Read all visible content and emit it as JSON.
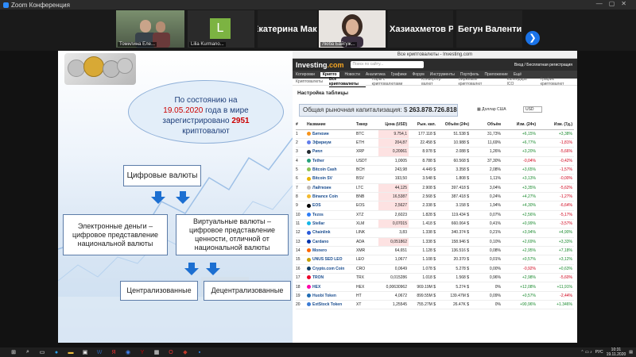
{
  "window": {
    "title": "Zoom Конференция"
  },
  "participants": [
    {
      "name": "Томилина Еле...",
      "kind": "video"
    },
    {
      "name": "Lilia Kurmano...",
      "kind": "avatar",
      "initial": "L"
    },
    {
      "name": "Екатерина Мак...",
      "kind": "name"
    },
    {
      "name": "Люба Байгуж...",
      "kind": "video"
    },
    {
      "name": "Хазиахметов Р...",
      "kind": "name"
    },
    {
      "name": "Бегун Валенти...",
      "kind": "name"
    }
  ],
  "gallery": {
    "next_label": "❯"
  },
  "slide": {
    "bubble_line1": "По состоянию на",
    "bubble_date": "19.05.2020",
    "bubble_line2": " года в мире",
    "bubble_line3": "зарегистрировано ",
    "bubble_count": "2951",
    "bubble_line4": "криптовалют",
    "digital": "Цифровые валюты",
    "electronic": "Электронные деньги – цифровое представление национальной валюты",
    "virtual": "Виртуальные валюты – цифровое представление ценности, отличной от национальной валюты",
    "centralized": "Централизованные",
    "decentralized": "Децентрализованные"
  },
  "browser": {
    "tab_title": "Все криптовалюты - Investing.com",
    "logo_main": "Investing",
    "logo_dot": ".com",
    "search_placeholder": "Поиск по сайту...",
    "header_right": "Вход / Бесплатная регистрация",
    "nav": [
      "Котировки",
      "Крипто",
      "Новости",
      "Аналитика",
      "Графики",
      "Форум",
      "Инструменты",
      "Портфель",
      "Приложение",
      "Ещё"
    ],
    "subnav": [
      "Криптовалюты",
      "Все криптовалюты",
      "Пары с криптовалютами",
      "Конвертер валют",
      "Биржевые криптовалют",
      "Календарь ICO",
      "График криптовалют"
    ],
    "section_title": "Настройка таблицы",
    "market_cap_label": "Общая рыночная капитализация: $ ",
    "market_cap_value": "263.878.726.818",
    "currency_label": "Доллар США",
    "currency_select": "USD",
    "columns": [
      "#",
      "Название",
      "Тикер",
      "Цена (USD)",
      "Рын. кап.",
      "Объём (24ч)",
      "Объём",
      "Изм. (24ч)",
      "Изм. (7д.)"
    ],
    "rows": [
      {
        "n": "1",
        "name": "Биткоин",
        "ticker": "BTC",
        "price": "9.754,1",
        "cap": "177.118 $",
        "vol": "51.538 $",
        "share": "31,73%",
        "c24": "+6,15%",
        "c7": "+3,38%",
        "color": "#f7931a"
      },
      {
        "n": "2",
        "name": "Эфириум",
        "ticker": "ETH",
        "price": "204,87",
        "cap": "22.458 $",
        "vol": "10.988 $",
        "share": "11,69%",
        "c24": "+6,77%",
        "c7": "-1,81%",
        "color": "#627eea"
      },
      {
        "n": "3",
        "name": "Рипл",
        "ticker": "XRP",
        "price": "0,20061",
        "cap": "8.978 $",
        "vol": "2.088 $",
        "share": "1,26%",
        "c24": "+3,20%",
        "c7": "-5,66%",
        "color": "#23292f"
      },
      {
        "n": "4",
        "name": "Tether",
        "ticker": "USDT",
        "price": "1,0005",
        "cap": "8.788 $",
        "vol": "60.568 $",
        "share": "37,30%",
        "c24": "-0,04%",
        "c7": "-0,42%",
        "color": "#26a17b"
      },
      {
        "n": "5",
        "name": "Bitcoin Cash",
        "ticker": "BCH",
        "price": "243,98",
        "cap": "4.449 $",
        "vol": "3.358 $",
        "share": "2,08%",
        "c24": "+3,65%",
        "c7": "-1,57%",
        "color": "#8dc351"
      },
      {
        "n": "6",
        "name": "Bitcoin SV",
        "ticker": "BSV",
        "price": "193,50",
        "cap": "3.548 $",
        "vol": "1.808 $",
        "share": "1,11%",
        "c24": "+3,13%",
        "c7": "-0,00%",
        "color": "#eab300"
      },
      {
        "n": "7",
        "name": "Лайткоин",
        "ticker": "LTC",
        "price": "44,125",
        "cap": "2.908 $",
        "vol": "397.418 $",
        "share": "3,04%",
        "c24": "+3,35%",
        "c7": "-5,62%",
        "color": "#bfbbbb"
      },
      {
        "n": "8",
        "name": "Binance Coin",
        "ticker": "BNB",
        "price": "16,5387",
        "cap": "2.568 $",
        "vol": "387.418 $",
        "share": "0,24%",
        "c24": "+4,27%",
        "c7": "-1,27%",
        "color": "#f3ba2f"
      },
      {
        "n": "9",
        "name": "EOS",
        "ticker": "EOS",
        "price": "2,5627",
        "cap": "2.338 $",
        "vol": "3.158 $",
        "share": "1,94%",
        "c24": "+4,30%",
        "c7": "-6,64%",
        "color": "#000000"
      },
      {
        "n": "10",
        "name": "Tezos",
        "ticker": "XTZ",
        "price": "2,6023",
        "cap": "1.828 $",
        "vol": "119.434 $",
        "share": "0,07%",
        "c24": "+2,56%",
        "c7": "-5,17%",
        "color": "#2c7df7"
      },
      {
        "n": "11",
        "name": "Stellar",
        "ticker": "XLM",
        "price": "0,07015",
        "cap": "1.418 $",
        "vol": "660.064 $",
        "share": "0,41%",
        "c24": "+0,99%",
        "c7": "-3,57%",
        "color": "#14b6e7"
      },
      {
        "n": "12",
        "name": "Chainlink",
        "ticker": "LINK",
        "price": "3,83",
        "cap": "1.338 $",
        "vol": "340.374 $",
        "share": "0,21%",
        "c24": "+3,94%",
        "c7": "+4,90%",
        "color": "#2a5ada"
      },
      {
        "n": "13",
        "name": "Cardano",
        "ticker": "ADA",
        "price": "0,051862",
        "cap": "1.338 $",
        "vol": "158.946 $",
        "share": "0,10%",
        "c24": "+2,69%",
        "c7": "+3,33%",
        "color": "#0033ad"
      },
      {
        "n": "14",
        "name": "Monero",
        "ticker": "XMR",
        "price": "64,651",
        "cap": "1.128 $",
        "vol": "136.516 $",
        "share": "0,08%",
        "c24": "+2,95%",
        "c7": "+7,18%",
        "color": "#ff6600"
      },
      {
        "n": "15",
        "name": "UNUS SED LEO",
        "ticker": "LEO",
        "price": "1,0677",
        "cap": "1.108 $",
        "vol": "20.370 $",
        "share": "0,01%",
        "c24": "+0,57%",
        "c7": "+3,12%",
        "color": "#c8a000"
      },
      {
        "n": "16",
        "name": "Crypto.com Coin",
        "ticker": "CRO",
        "price": "0,0649",
        "cap": "1.078 $",
        "vol": "5.278 $",
        "share": "0,00%",
        "c24": "-0,92%",
        "c7": "+0,63%",
        "color": "#103f68"
      },
      {
        "n": "17",
        "name": "TRON",
        "ticker": "TRX",
        "price": "0,015286",
        "cap": "1.018 $",
        "vol": "1.568 $",
        "share": "0,96%",
        "c24": "+2,98%",
        "c7": "-5,60%",
        "color": "#eb0029"
      },
      {
        "n": "18",
        "name": "HEX",
        "ticker": "HEX",
        "price": "0,00630962",
        "cap": "969.19M $",
        "vol": "5.274 $",
        "share": "0%",
        "c24": "+12,08%",
        "c7": "+11,91%",
        "color": "#ff00aa"
      },
      {
        "n": "19",
        "name": "Huobi Token",
        "ticker": "HT",
        "price": "4,0672",
        "cap": "899.55M $",
        "vol": "139.47M $",
        "share": "0,09%",
        "c24": "+0,57%",
        "c7": "-2,44%",
        "color": "#1f6cb4"
      },
      {
        "n": "20",
        "name": "ExtStock Token",
        "ticker": "XT",
        "price": "1,25545",
        "cap": "755.27M $",
        "vol": "26.47K $",
        "share": "0%",
        "c24": "+90,96%",
        "c7": "+1.346%",
        "color": "#3a7bd5"
      }
    ]
  },
  "taskbar": {
    "lang": "РУС",
    "time": "10:31",
    "date": "19.11.2020"
  }
}
